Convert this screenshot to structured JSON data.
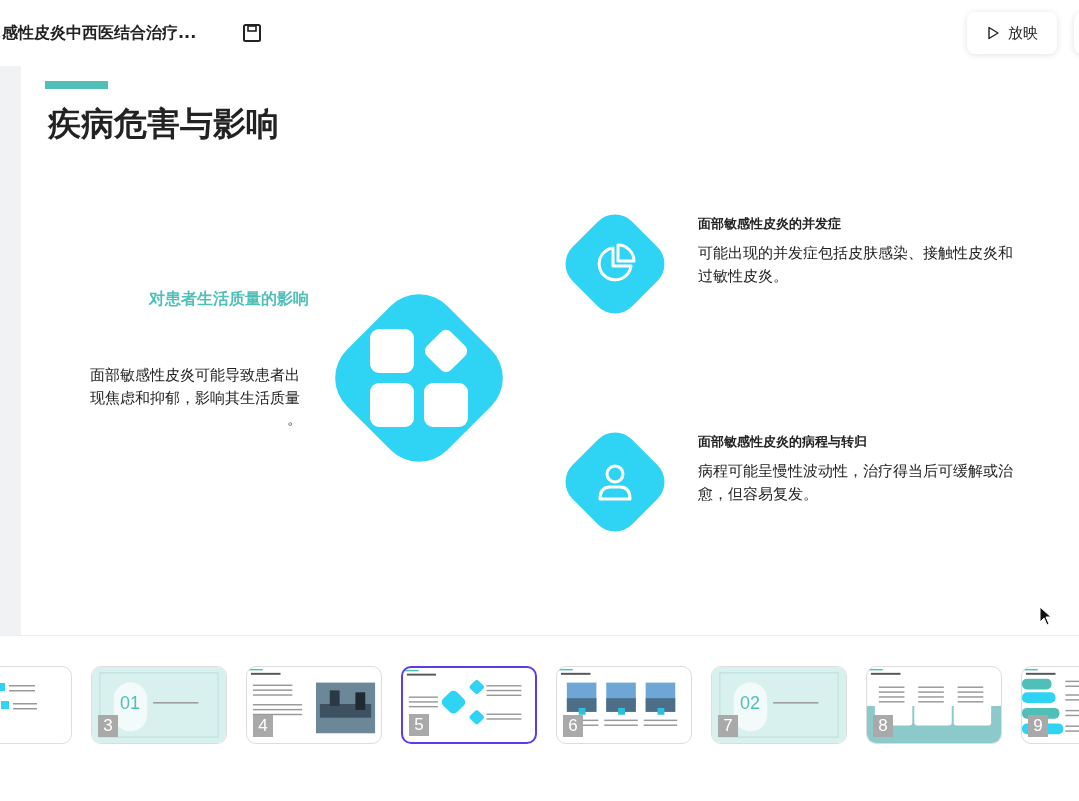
{
  "toolbar": {
    "title": "感性皮炎中西医结合治疗...",
    "play_label": "放映"
  },
  "slide": {
    "title": "疾病危害与影响",
    "left": {
      "heading": "对患者生活质量的影响",
      "body": "面部敏感性皮炎可能导致患者出现焦虑和抑郁，影响其生活质量",
      "tail": "。"
    },
    "points": [
      {
        "heading": "面部敏感性皮炎的并发症",
        "body": "可能出现的并发症包括皮肤感染、接触性皮炎和过敏性皮炎。"
      },
      {
        "heading": "面部敏感性皮炎的病程与转归",
        "body": "病程可能呈慢性波动性，治疗得当后可缓解或治愈，但容易复发。"
      }
    ]
  },
  "thumbnails": [
    {
      "kind": "list",
      "selected": false
    },
    {
      "kind": "section",
      "number": "3",
      "big_number": "01",
      "selected": false
    },
    {
      "kind": "photo",
      "number": "4",
      "selected": false
    },
    {
      "kind": "diamonds",
      "number": "5",
      "selected": true
    },
    {
      "kind": "photos",
      "number": "6",
      "selected": false
    },
    {
      "kind": "section",
      "number": "7",
      "big_number": "02",
      "selected": false
    },
    {
      "kind": "cards",
      "number": "8",
      "selected": false
    },
    {
      "kind": "steps",
      "number": "9",
      "selected": false
    }
  ]
}
